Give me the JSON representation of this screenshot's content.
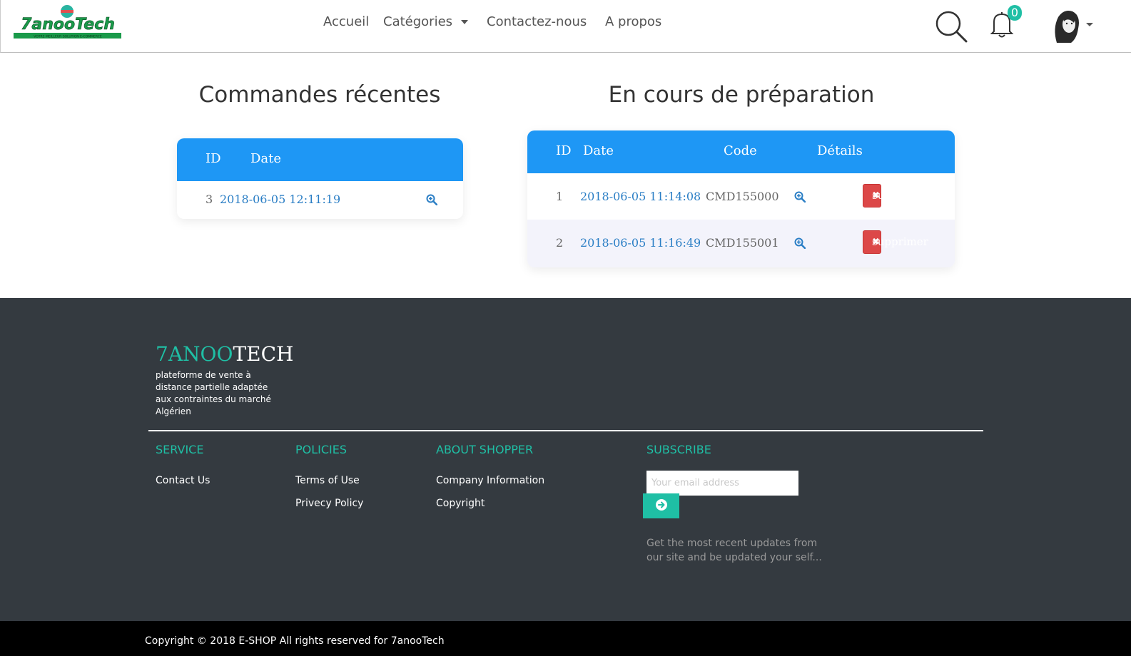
{
  "nav": {
    "logo_text": "7anooTech",
    "logo_tagline": "VOTRE MEILLEUR SOLUTION E-COMMERCE",
    "links": [
      "Accueil",
      "Catégories",
      "Contactez-nous",
      "A propos"
    ],
    "notifications_count": "0"
  },
  "recent": {
    "title": "Commandes récentes",
    "headers": {
      "id": "ID",
      "date": "Date"
    },
    "rows": [
      {
        "id": "3",
        "date": "2018-06-05 12:11:19"
      }
    ]
  },
  "preparing": {
    "title": "En cours de préparation",
    "headers": {
      "id": "ID",
      "date": "Date",
      "code": "Code",
      "details": "Détails"
    },
    "rows": [
      {
        "id": "1",
        "date": "2018-06-05 11:14:08",
        "code": "CMD155000",
        "action": "supprimer"
      },
      {
        "id": "2",
        "date": "2018-06-05 11:16:49",
        "code": "CMD155001",
        "action": "supprimer"
      }
    ]
  },
  "footer": {
    "brand_part1": "7ANOO",
    "brand_part2": "TECH",
    "tagline": "plateforme de vente à distance partielle adaptée aux contraintes du marché Algérien",
    "service": {
      "title": "SERVICE",
      "links": [
        "Contact Us"
      ]
    },
    "policies": {
      "title": "POLICIES",
      "links": [
        "Terms of Use",
        "Privecy Policy"
      ]
    },
    "about": {
      "title": "ABOUT SHOPPER",
      "links": [
        "Company Information",
        "Copyright"
      ]
    },
    "subscribe": {
      "title": "SUBSCRIBE",
      "placeholder": "Your email address",
      "text": "Get the most recent updates from our site and be updated your self..."
    },
    "copyright": "Copyright © 2018 E-SHOP All rights reserved for 7anooTech"
  },
  "colors": {
    "primary": "#1e97f5",
    "accent": "#1fbfa5",
    "danger": "#dc4848",
    "footer_bg": "#343a40"
  }
}
